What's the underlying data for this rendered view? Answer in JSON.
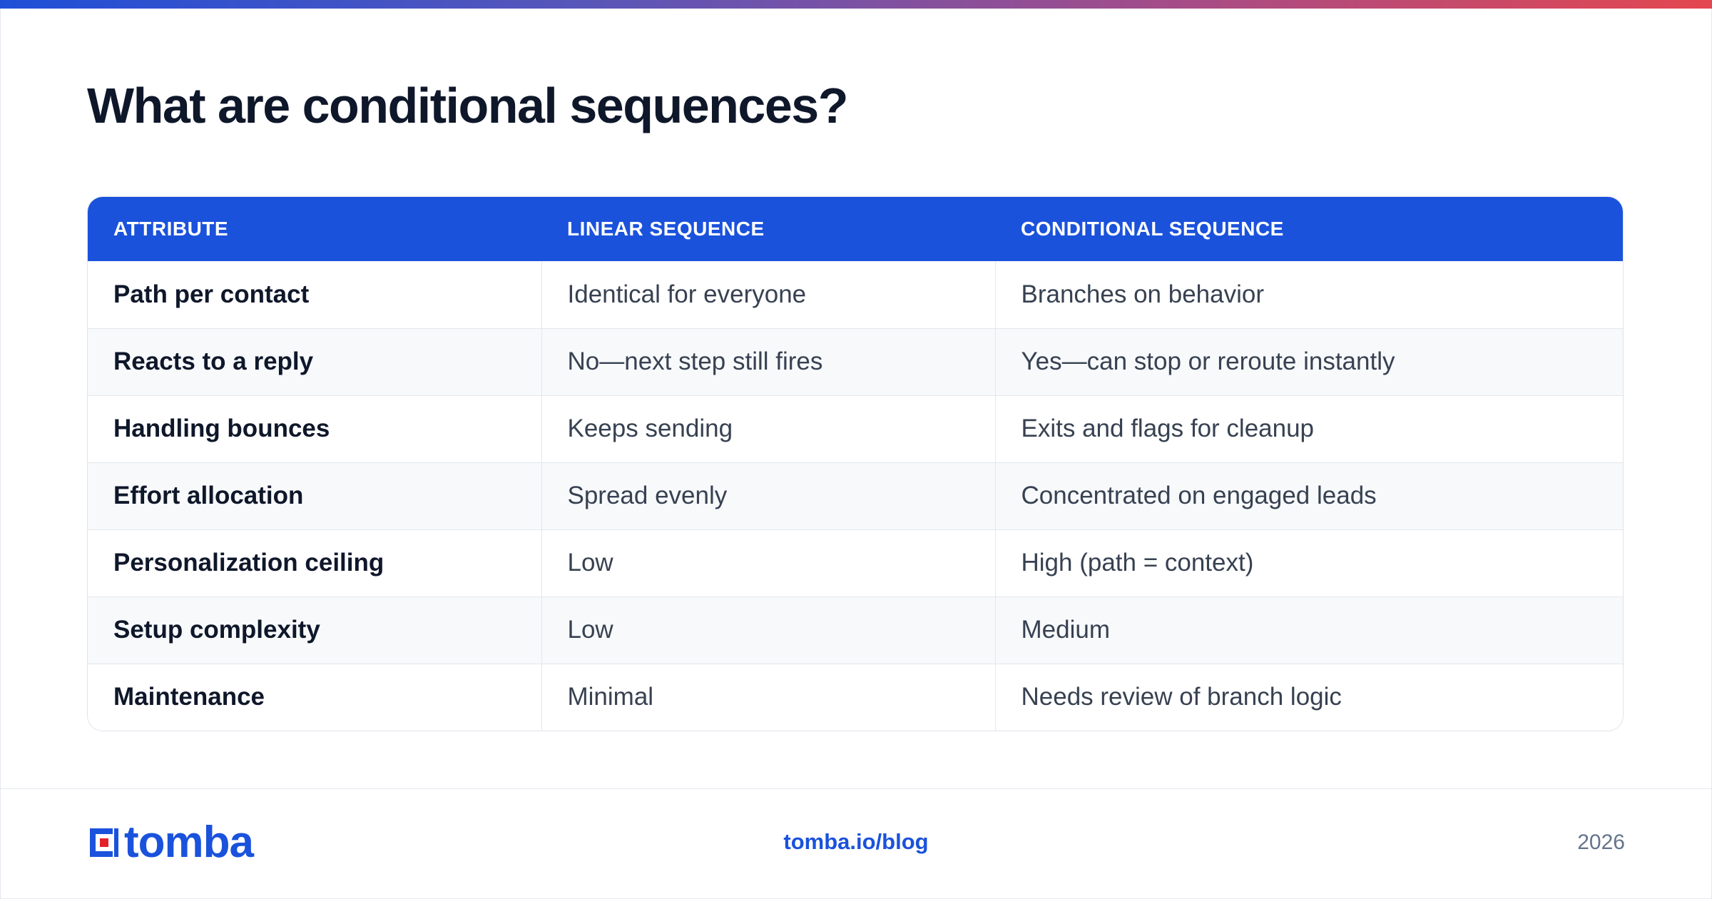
{
  "page": {
    "title": "What are conditional sequences?"
  },
  "table": {
    "headers": [
      "ATTRIBUTE",
      "LINEAR SEQUENCE",
      "CONDITIONAL SEQUENCE"
    ],
    "rows": [
      [
        "Path per contact",
        "Identical for everyone",
        "Branches on behavior"
      ],
      [
        "Reacts to a reply",
        "No—next step still fires",
        "Yes—can stop or reroute instantly"
      ],
      [
        "Handling bounces",
        "Keeps sending",
        "Exits and flags for cleanup"
      ],
      [
        "Effort allocation",
        "Spread evenly",
        "Concentrated on engaged leads"
      ],
      [
        "Personalization ceiling",
        "Low",
        "High (path = context)"
      ],
      [
        "Setup complexity",
        "Low",
        "Medium"
      ],
      [
        "Maintenance",
        "Minimal",
        "Needs review of branch logic"
      ]
    ]
  },
  "footer": {
    "brand": "tomba",
    "link": "tomba.io/blog",
    "year": "2026"
  },
  "colors": {
    "brand_blue": "#1a52dc",
    "brand_red": "#e4202a",
    "title": "#0f172a"
  }
}
